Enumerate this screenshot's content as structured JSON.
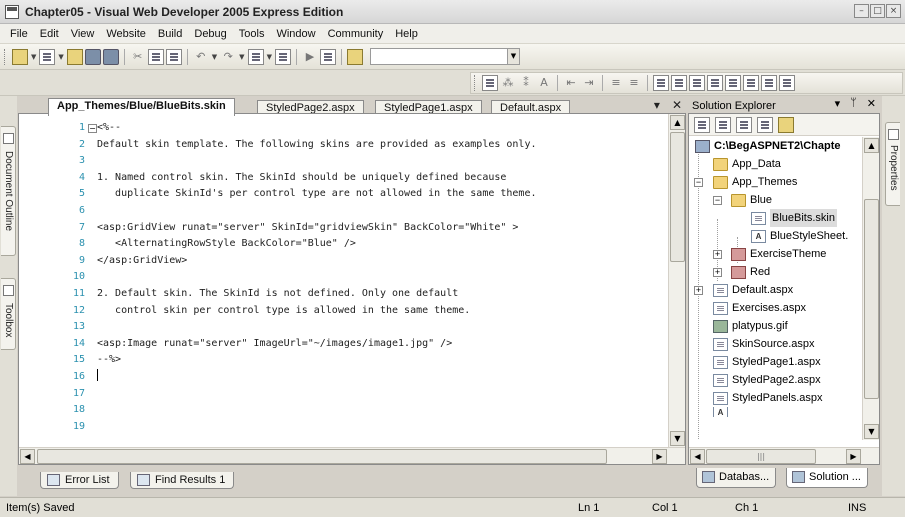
{
  "window": {
    "title": "Chapter05 - Visual Web Developer 2005 Express Edition"
  },
  "menu": [
    "File",
    "Edit",
    "View",
    "Website",
    "Build",
    "Debug",
    "Tools",
    "Window",
    "Community",
    "Help"
  ],
  "left_strip": {
    "document_outline": "Document Outline",
    "toolbox": "Toolbox"
  },
  "right_strip": {
    "properties": "Properties"
  },
  "doc_tabs": [
    {
      "label": "App_Themes/Blue/BlueBits.skin",
      "active": true
    },
    {
      "label": "StyledPage2.aspx",
      "active": false
    },
    {
      "label": "StyledPage1.aspx",
      "active": false
    },
    {
      "label": "Default.aspx",
      "active": false
    }
  ],
  "code_lines": [
    {
      "n": "1",
      "text": "<%--"
    },
    {
      "n": "2",
      "text": "Default skin template. The following skins are provided as examples only."
    },
    {
      "n": "3",
      "text": ""
    },
    {
      "n": "4",
      "text": "1. Named control skin. The SkinId should be uniquely defined because"
    },
    {
      "n": "5",
      "text": "   duplicate SkinId's per control type are not allowed in the same theme."
    },
    {
      "n": "6",
      "text": ""
    },
    {
      "n": "7",
      "text": "<asp:GridView runat=\"server\" SkinId=\"gridviewSkin\" BackColor=\"White\" >"
    },
    {
      "n": "8",
      "text": "   <AlternatingRowStyle BackColor=\"Blue\" />"
    },
    {
      "n": "9",
      "text": "</asp:GridView>"
    },
    {
      "n": "10",
      "text": ""
    },
    {
      "n": "11",
      "text": "2. Default skin. The SkinId is not defined. Only one default"
    },
    {
      "n": "12",
      "text": "   control skin per control type is allowed in the same theme."
    },
    {
      "n": "13",
      "text": ""
    },
    {
      "n": "14",
      "text": "<asp:Image runat=\"server\" ImageUrl=\"~/images/image1.jpg\" />"
    },
    {
      "n": "15",
      "text": "--%>"
    },
    {
      "n": "16",
      "text": ""
    },
    {
      "n": "17",
      "text": ""
    },
    {
      "n": "18",
      "text": ""
    },
    {
      "n": "19",
      "text": ""
    }
  ],
  "bottom_tabs": [
    "Error List",
    "Find Results 1"
  ],
  "solution_explorer": {
    "title": "Solution Explorer",
    "root": "C:\\BegASPNET2\\Chapte",
    "items": [
      {
        "label": "App_Data"
      },
      {
        "label": "App_Themes"
      },
      {
        "label": "Blue"
      },
      {
        "label": "BlueBits.skin"
      },
      {
        "label": "BlueStyleSheet."
      },
      {
        "label": "ExerciseTheme"
      },
      {
        "label": "Red"
      },
      {
        "label": "Default.aspx"
      },
      {
        "label": "Exercises.aspx"
      },
      {
        "label": "platypus.gif"
      },
      {
        "label": "SkinSource.aspx"
      },
      {
        "label": "StyledPage1.aspx"
      },
      {
        "label": "StyledPage2.aspx"
      },
      {
        "label": "StyledPanels.aspx"
      }
    ],
    "bottom_tabs": [
      "Databas...",
      "Solution ..."
    ]
  },
  "status": {
    "message": "Item(s) Saved",
    "ln": "Ln 1",
    "col": "Col 1",
    "ch": "Ch 1",
    "mode": "INS"
  }
}
